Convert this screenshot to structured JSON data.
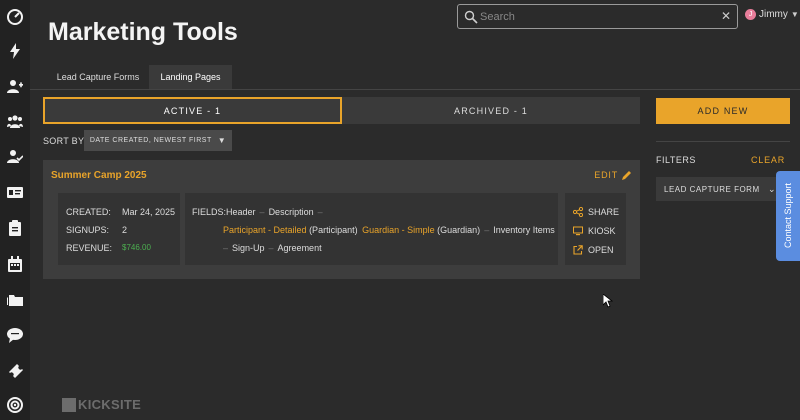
{
  "page": {
    "title": "Marketing Tools"
  },
  "search": {
    "placeholder": "Search",
    "clear_icon": "close-icon"
  },
  "user": {
    "initial": "J",
    "name": "Jimmy"
  },
  "tabs": [
    {
      "label": "Lead Capture Forms",
      "active": false
    },
    {
      "label": "Landing Pages",
      "active": true
    }
  ],
  "segments": {
    "active_label": "ACTIVE - 1",
    "archived_label": "ARCHIVED - 1"
  },
  "sort": {
    "label": "SORT BY",
    "selected": "DATE CREATED, NEWEST FIRST"
  },
  "card": {
    "title": "Summer Camp 2025",
    "edit_label": "EDIT",
    "stats": {
      "created_label": "CREATED:",
      "created_value": "Mar 24, 2025",
      "signups_label": "SIGNUPS:",
      "signups_value": "2",
      "revenue_label": "REVENUE:",
      "revenue_value": "$746.00"
    },
    "fields": {
      "label": "FIELDS:",
      "header": "Header",
      "description": "Description",
      "participant": "Participant - Detailed",
      "participant_role": "(Participant)",
      "guardian": "Guardian - Simple",
      "guardian_role": "(Guardian)",
      "inventory": "Inventory Items",
      "signup": "Sign-Up",
      "agreement": "Agreement",
      "separator": "–"
    },
    "actions": {
      "share": "SHARE",
      "kiosk": "KIOSK",
      "open": "OPEN"
    }
  },
  "right": {
    "add_new": "ADD NEW",
    "filters_label": "FILTERS",
    "clear_label": "CLEAR",
    "filter_item": "LEAD CAPTURE FORM",
    "support": "Contact Support"
  },
  "brand": {
    "logo": "KICKSITE"
  },
  "colors": {
    "accent": "#e9a42a",
    "money": "#4caf50",
    "support": "#5b8de0",
    "background": "#2b2b2b"
  }
}
